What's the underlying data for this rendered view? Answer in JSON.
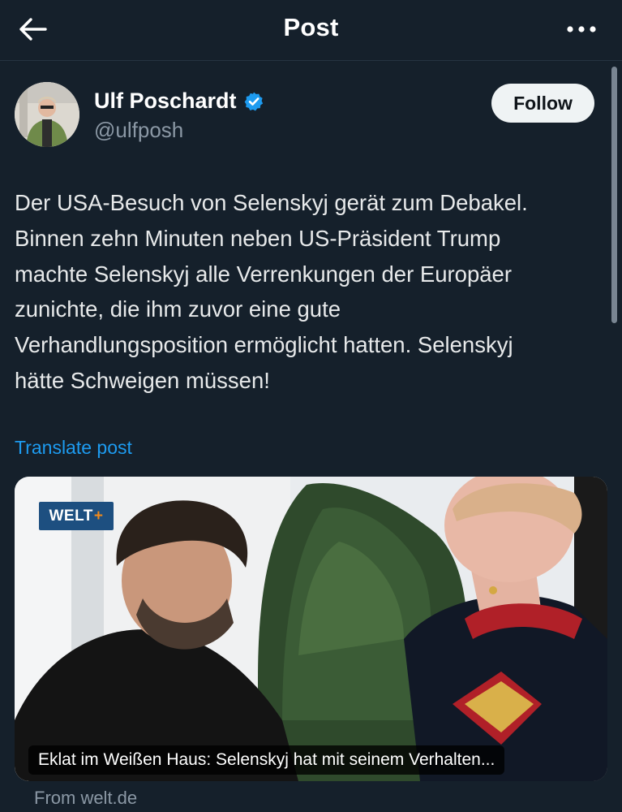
{
  "header": {
    "title": "Post",
    "back_icon": "arrow-left-icon",
    "more_icon": "more-horizontal-icon"
  },
  "author": {
    "display_name": "Ulf Poschardt",
    "handle": "@ulfposh",
    "verified": true,
    "verified_icon": "verified-badge-icon",
    "follow_label": "Follow"
  },
  "post": {
    "lines": [
      "Der USA-Besuch von Selenskyj gerät zum Debakel.",
      "Binnen zehn Minuten neben US-Präsident Trump",
      "machte Selenskyj alle Verrenkungen der Europäer",
      "zunichte, die ihm zuvor eine gute",
      "Verhandlungsposition ermöglicht hatten. Selenskyj",
      "hätte Schweigen müssen!"
    ],
    "translate_label": "Translate post"
  },
  "link_card": {
    "publisher_badge": "WELT",
    "publisher_badge_plus": "+",
    "caption": "Eklat im Weißen Haus: Selenskyj hat mit seinem Verhalten...",
    "source": "From welt.de"
  },
  "colors": {
    "background": "#15202b",
    "accent": "#1d9bf0",
    "secondary_text": "#8b98a5",
    "follow_button_bg": "#eff3f4"
  }
}
